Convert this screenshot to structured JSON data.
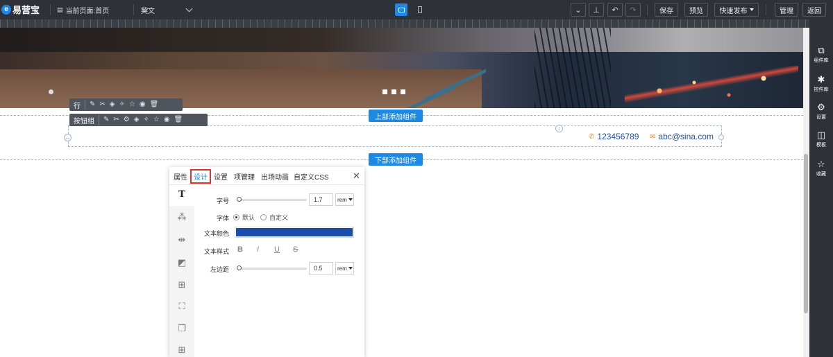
{
  "topbar": {
    "logo_text": "易营宝",
    "current_page": "当前页面:首页",
    "language": "英文",
    "save": "保存",
    "preview": "预览",
    "quick_publish": "快速发布",
    "manage": "管理",
    "back": "返回"
  },
  "canvas": {
    "add_above": "上部添加组件",
    "add_below": "下部添加组件",
    "row_toolbar_label": "行",
    "button_group_label": "按钮组",
    "phone": "123456789",
    "email": "abc@sina.com"
  },
  "rightbar": {
    "items": [
      {
        "label": "组件库",
        "icon": "copy-icon"
      },
      {
        "label": "控件库",
        "icon": "puzzle-icon"
      },
      {
        "label": "设置",
        "icon": "gear-icon"
      },
      {
        "label": "模板",
        "icon": "layout-icon"
      },
      {
        "label": "收藏",
        "icon": "star-icon"
      }
    ]
  },
  "panel": {
    "tabs": [
      "属性",
      "设计",
      "设置",
      "项管理",
      "出场动画",
      "自定义CSS"
    ],
    "active_tab": "设计",
    "font_size_label": "字号",
    "font_size_value": "1.7",
    "font_size_unit": "rem",
    "font_family_label": "字体",
    "font_default": "默认",
    "font_custom": "自定义",
    "text_color_label": "文本颜色",
    "text_color_value": "#1c4ea8",
    "text_style_label": "文本样式",
    "style_bold": "B",
    "style_italic": "I",
    "style_underline": "U",
    "style_strike": "S",
    "left_margin_label": "左边距",
    "left_margin_value": "0.5",
    "left_margin_unit": "rem",
    "side_icon_text": "T"
  },
  "colors": {
    "accent": "#1e88e5",
    "topbar_bg": "#2e3238",
    "active_tab_highlight": "#d9352b"
  }
}
